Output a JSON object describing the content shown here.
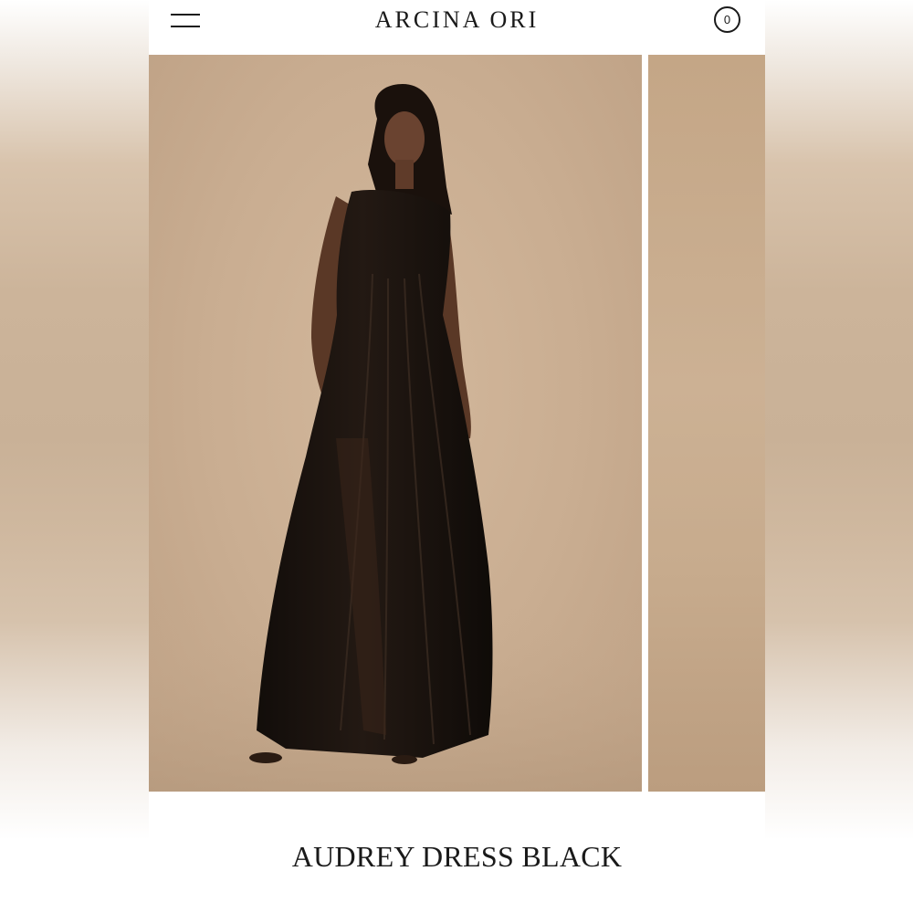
{
  "header": {
    "brand": "ARCINA ORI",
    "cart_count": "0"
  },
  "product": {
    "title": "AUDREY DRESS BLACK"
  },
  "gallery": {
    "current_image_description": "model wearing sheer black pleated maxi dress"
  },
  "colors": {
    "backdrop": "#c9ad91",
    "dress": "#1b1410",
    "text": "#1a1a1a"
  }
}
